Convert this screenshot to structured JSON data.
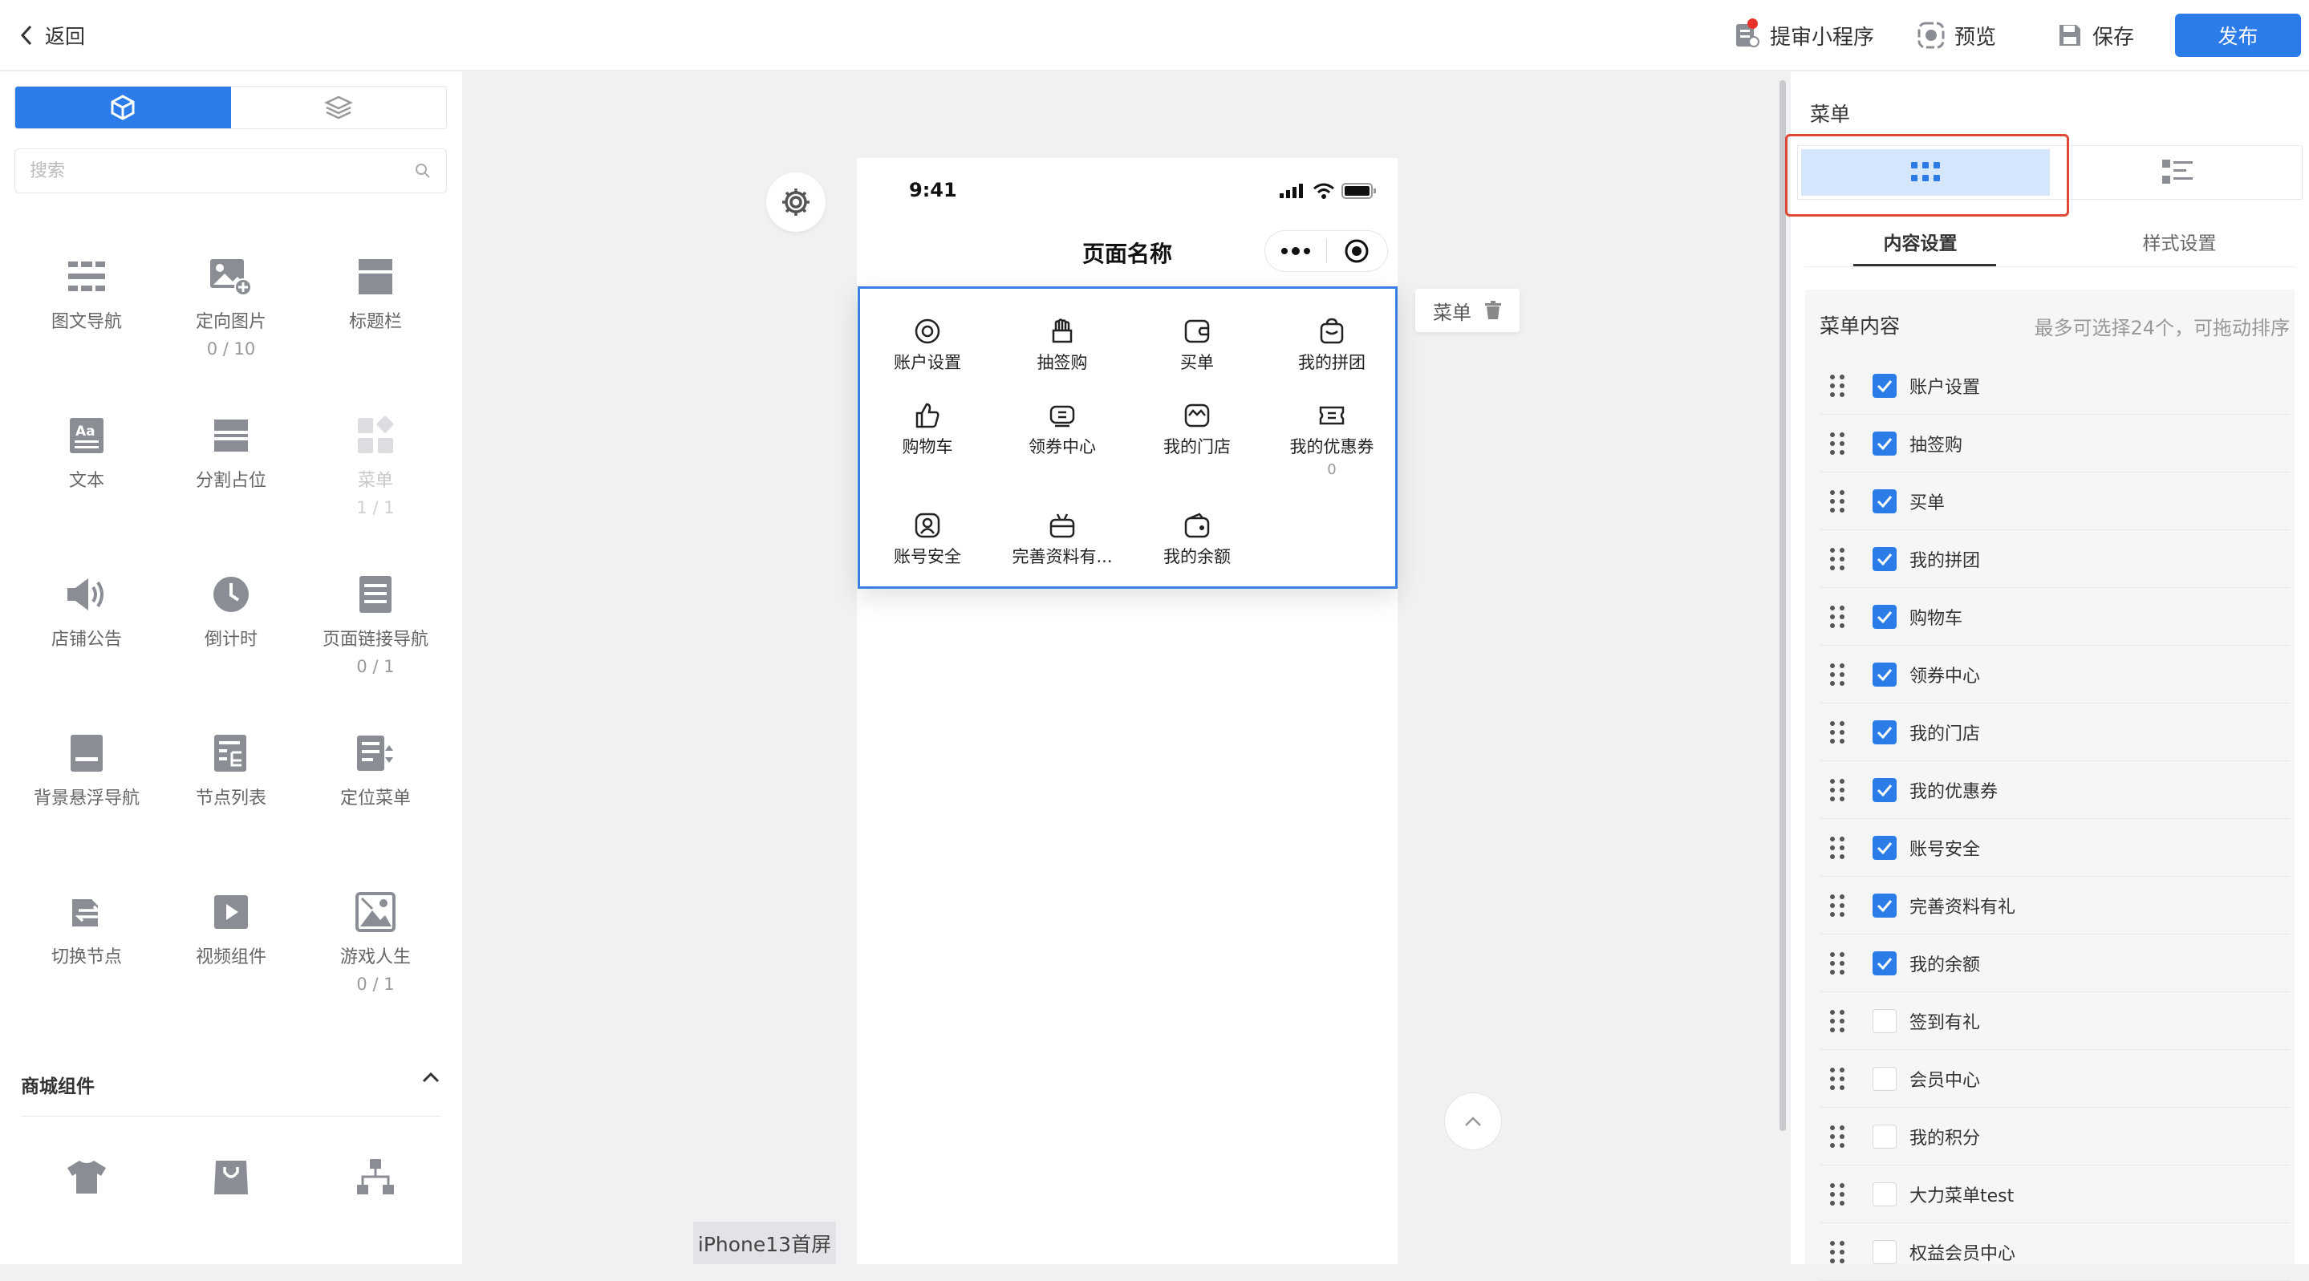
{
  "topbar": {
    "back_label": "返回",
    "submit_label": "提审小程序",
    "preview_label": "预览",
    "save_label": "保存",
    "publish_label": "发布"
  },
  "left": {
    "search_placeholder": "搜索",
    "components": [
      {
        "label": "图文导航",
        "count": "",
        "icon": "grid-nav-icon"
      },
      {
        "label": "定向图片",
        "count": "0 / 10",
        "icon": "image-plus-icon"
      },
      {
        "label": "标题栏",
        "count": "",
        "icon": "title-bar-icon"
      },
      {
        "label": "文本",
        "count": "",
        "icon": "text-icon"
      },
      {
        "label": "分割占位",
        "count": "",
        "icon": "divider-icon"
      },
      {
        "label": "菜单",
        "count": "1 / 1",
        "icon": "menu-grid-icon",
        "disabled": true
      },
      {
        "label": "店铺公告",
        "count": "",
        "icon": "speaker-icon"
      },
      {
        "label": "倒计时",
        "count": "",
        "icon": "clock-icon"
      },
      {
        "label": "页面链接导航",
        "count": "0 / 1",
        "icon": "page-link-icon"
      },
      {
        "label": "背景悬浮导航",
        "count": "",
        "icon": "floating-nav-icon"
      },
      {
        "label": "节点列表",
        "count": "",
        "icon": "node-list-icon"
      },
      {
        "label": "定位菜单",
        "count": "",
        "icon": "locate-menu-icon"
      },
      {
        "label": "切换节点",
        "count": "",
        "icon": "switch-node-icon"
      },
      {
        "label": "视频组件",
        "count": "",
        "icon": "video-icon"
      },
      {
        "label": "游戏人生",
        "count": "0 / 1",
        "icon": "game-image-icon"
      }
    ],
    "section_title": "商城组件"
  },
  "phone": {
    "time": "9:41",
    "page_title": "页面名称",
    "menu_items": [
      {
        "label": "账户设置",
        "icon": "settings-circle-icon"
      },
      {
        "label": "抽签购",
        "icon": "lottery-hand-icon"
      },
      {
        "label": "买单",
        "icon": "wallet-icon"
      },
      {
        "label": "我的拼团",
        "icon": "group-bag-icon"
      },
      {
        "label": "购物车",
        "icon": "thumb-up-icon"
      },
      {
        "label": "领券中心",
        "icon": "coupon-center-icon"
      },
      {
        "label": "我的门店",
        "icon": "store-icon"
      },
      {
        "label": "我的优惠券",
        "icon": "ticket-icon",
        "sub": "0"
      },
      {
        "label": "账号安全",
        "icon": "shield-user-icon"
      },
      {
        "label": "完善资料有...",
        "icon": "gift-icon"
      },
      {
        "label": "我的余额",
        "icon": "balance-wallet-icon"
      }
    ],
    "menu_tag": "菜单",
    "device_label": "iPhone13首屏"
  },
  "right": {
    "title": "菜单",
    "tab_content": "内容设置",
    "tab_style": "样式设置",
    "box_title": "菜单内容",
    "box_hint": "最多可选择24个，可拖动排序",
    "items": [
      {
        "label": "账户设置",
        "checked": true
      },
      {
        "label": "抽签购",
        "checked": true
      },
      {
        "label": "买单",
        "checked": true
      },
      {
        "label": "我的拼团",
        "checked": true
      },
      {
        "label": "购物车",
        "checked": true
      },
      {
        "label": "领券中心",
        "checked": true
      },
      {
        "label": "我的门店",
        "checked": true
      },
      {
        "label": "我的优惠券",
        "checked": true
      },
      {
        "label": "账号安全",
        "checked": true
      },
      {
        "label": "完善资料有礼",
        "checked": true
      },
      {
        "label": "我的余额",
        "checked": true
      },
      {
        "label": "签到有礼",
        "checked": false
      },
      {
        "label": "会员中心",
        "checked": false
      },
      {
        "label": "我的积分",
        "checked": false
      },
      {
        "label": "大力菜单test",
        "checked": false
      },
      {
        "label": "权益会员中心",
        "checked": false
      }
    ]
  },
  "colors": {
    "accent": "#2b7ce8",
    "highlight": "#e04836"
  }
}
